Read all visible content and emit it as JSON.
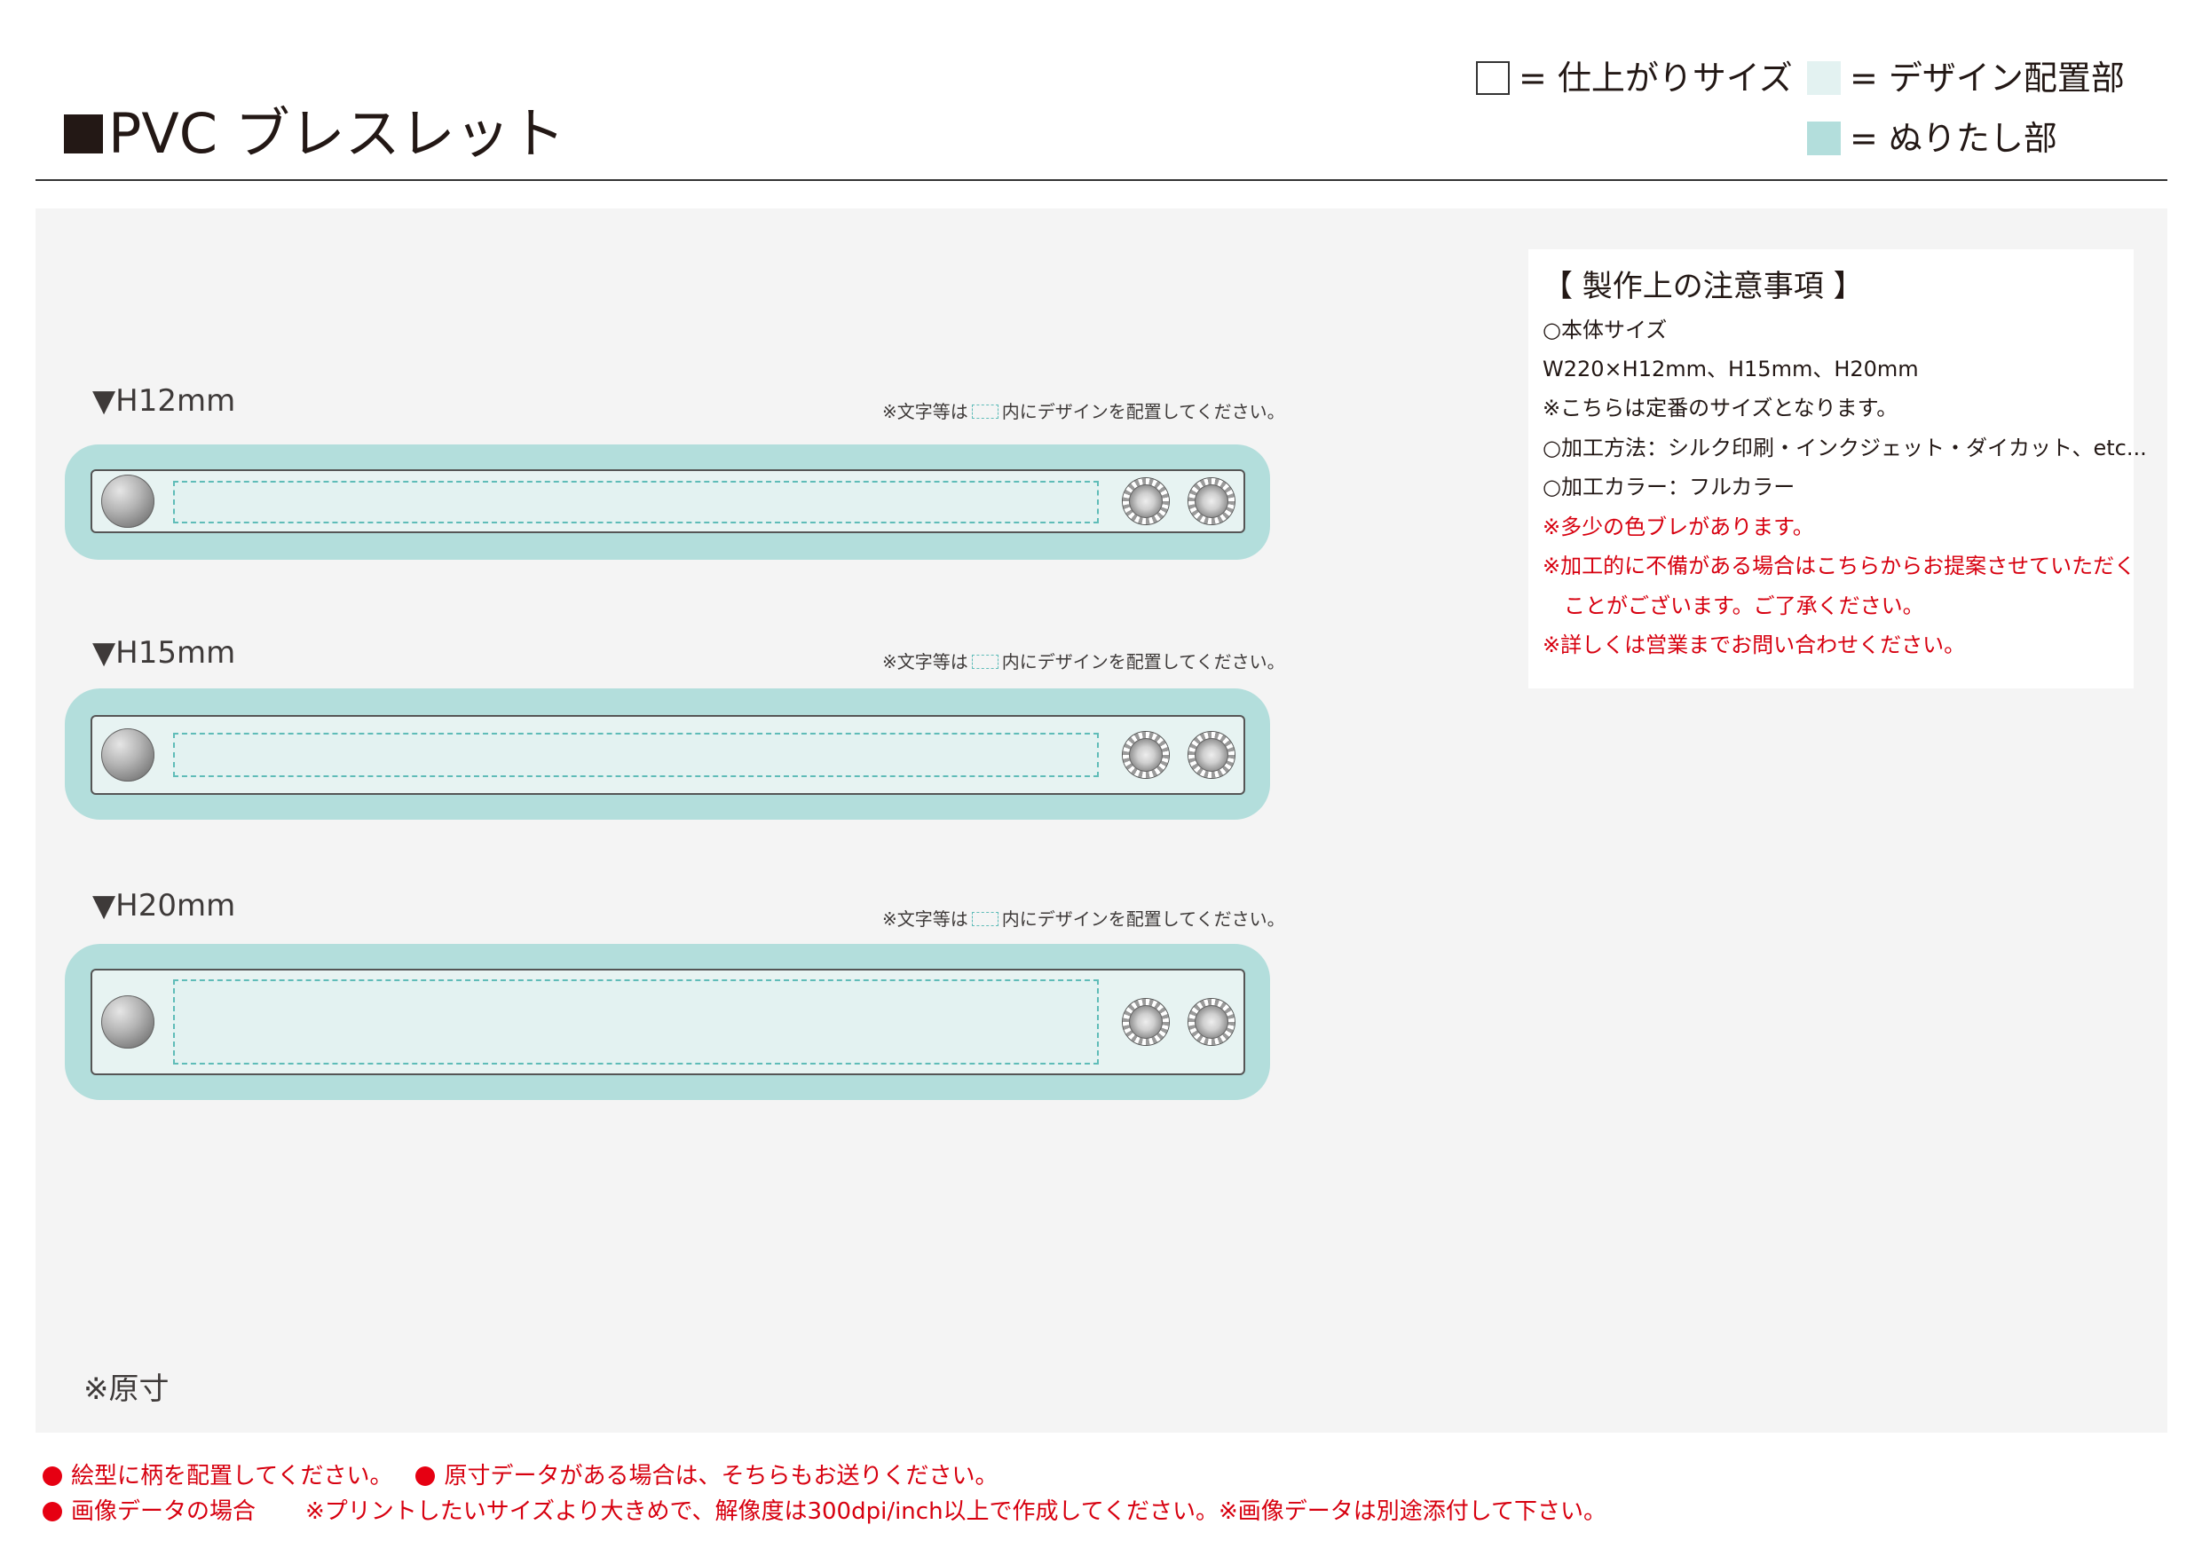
{
  "header": {
    "title": "PVC ブレスレット",
    "legend": {
      "finish": "= 仕上がりサイズ",
      "design": "= デザイン配置部",
      "bleed": "= ぬりたし部"
    }
  },
  "bands": [
    {
      "label": "▼H12mm",
      "note_prefix": "※文字等は",
      "note_suffix": "内にデザインを配置してください。"
    },
    {
      "label": "▼H15mm",
      "note_prefix": "※文字等は",
      "note_suffix": "内にデザインを配置してください。"
    },
    {
      "label": "▼H20mm",
      "note_prefix": "※文字等は",
      "note_suffix": "内にデザインを配置してください。"
    }
  ],
  "notes": {
    "title": "【 製作上の注意事項 】",
    "lines": [
      "○本体サイズ",
      "W220×H12mm、H15mm、H20mm",
      "※こちらは定番のサイズとなります。",
      "○加工方法：シルク印刷・インクジェット・ダイカット、etc...",
      "○加工カラー：フルカラー"
    ],
    "warnings": [
      "※多少の色ブレがあります。",
      "※加工的に不備がある場合はこちらからお提案させていただく",
      "　ことがございます。ご了承ください。",
      "※詳しくは営業までお問い合わせください。"
    ]
  },
  "scale_note": "※原寸",
  "footer": {
    "line1a": "絵型に柄を配置してください。",
    "line1b": "原寸データがある場合は、そちらもお送りください。",
    "line2a": "画像データの場合",
    "line2b": "※プリントしたいサイズより大きめで、解像度は300dpi/inch以上で作成してください。※画像データは別途添付して下さい。"
  },
  "colors": {
    "bleed": "#b3dedc",
    "design_area": "#e3f2f1",
    "dashed_guide": "#5fbcb8",
    "warning_red": "#d7000f",
    "panel_bg": "#f4f4f4"
  }
}
